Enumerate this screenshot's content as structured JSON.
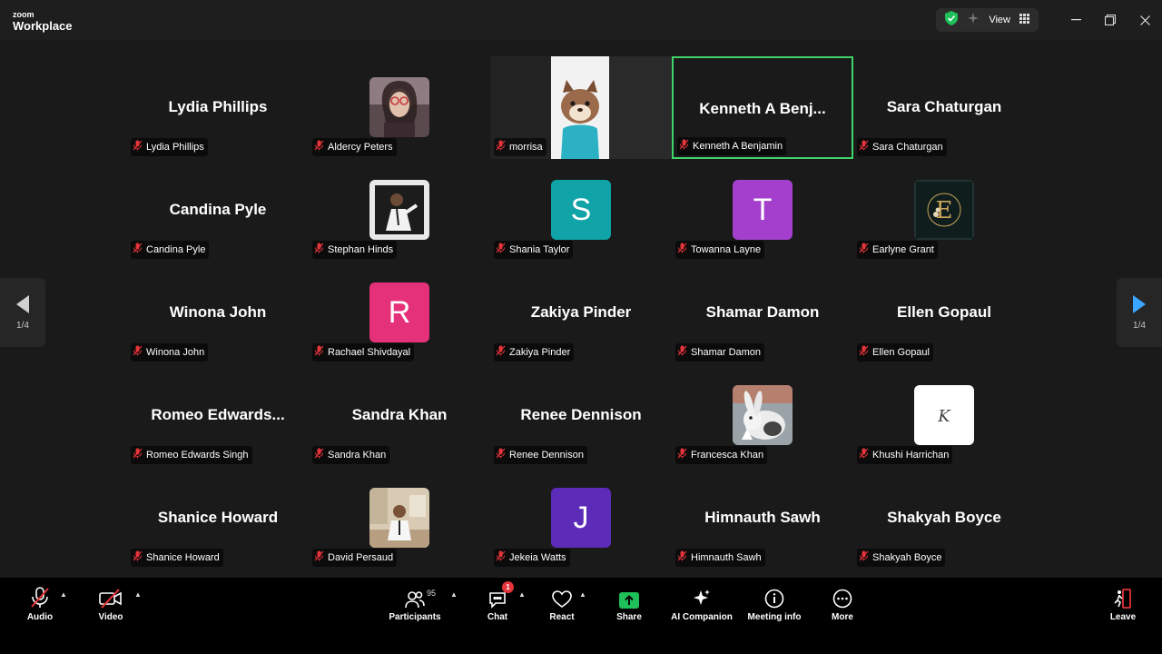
{
  "app": {
    "brand_top": "zoom",
    "brand_main": "Workplace"
  },
  "titlebar": {
    "view_label": "View"
  },
  "pagination": {
    "left": "1/4",
    "right": "1/4"
  },
  "tiles": [
    {
      "name": "Lydia Phillips",
      "big": "Lydia Phillips",
      "kind": "name"
    },
    {
      "name": "Aldercy Peters",
      "kind": "photo",
      "photo": "woman-glasses"
    },
    {
      "name": "morrisa",
      "kind": "video"
    },
    {
      "name": "Kenneth A Benjamin",
      "big": "Kenneth  A  Benj...",
      "kind": "name",
      "active": true
    },
    {
      "name": "Sara Chaturgan",
      "big": "Sara Chaturgan",
      "kind": "name"
    },
    {
      "name": "Candina Pyle",
      "big": "Candina Pyle",
      "kind": "name"
    },
    {
      "name": "Stephan Hinds",
      "kind": "photo",
      "photo": "man-dark"
    },
    {
      "name": "Shania Taylor",
      "kind": "letter",
      "letter": "S",
      "color": "#10a3a7"
    },
    {
      "name": "Towanna Layne",
      "kind": "letter",
      "letter": "T",
      "color": "#a33fcc"
    },
    {
      "name": "Earlyne Grant",
      "kind": "photo",
      "photo": "logo-e"
    },
    {
      "name": "Winona John",
      "big": "Winona John",
      "kind": "name"
    },
    {
      "name": "Rachael Shivdayal",
      "kind": "letter",
      "letter": "R",
      "color": "#e5317a"
    },
    {
      "name": "Zakiya Pinder",
      "big": "Zakiya Pinder",
      "kind": "name"
    },
    {
      "name": "Shamar Damon",
      "big": "Shamar Damon",
      "kind": "name"
    },
    {
      "name": "Ellen Gopaul",
      "big": "Ellen Gopaul",
      "kind": "name"
    },
    {
      "name": "Romeo Edwards Singh",
      "big": "Romeo  Edwards...",
      "kind": "name"
    },
    {
      "name": "Sandra Khan",
      "big": "Sandra Khan",
      "kind": "name"
    },
    {
      "name": "Renee Dennison",
      "big": "Renee Dennison",
      "kind": "name"
    },
    {
      "name": "Francesca Khan",
      "kind": "photo",
      "photo": "rabbit"
    },
    {
      "name": "Khushi Harrichan",
      "kind": "photo",
      "photo": "monogram-k"
    },
    {
      "name": "Shanice Howard",
      "big": "Shanice Howard",
      "kind": "name"
    },
    {
      "name": "David Persaud",
      "kind": "photo",
      "photo": "man-room"
    },
    {
      "name": "Jekeia Watts",
      "kind": "letter",
      "letter": "J",
      "color": "#5c2bb8"
    },
    {
      "name": "Himnauth Sawh",
      "big": "Himnauth Sawh",
      "kind": "name"
    },
    {
      "name": "Shakyah Boyce",
      "big": "Shakyah Boyce",
      "kind": "name"
    }
  ],
  "toolbar": {
    "audio": "Audio",
    "video": "Video",
    "participants": "Participants",
    "participants_count": "95",
    "chat": "Chat",
    "chat_badge": "1",
    "react": "React",
    "share": "Share",
    "ai": "AI Companion",
    "info": "Meeting info",
    "more": "More",
    "leave": "Leave"
  },
  "colors": {
    "active_border": "#3fd36a",
    "share_green": "#1fbf5a",
    "mute_red": "#e5343a",
    "nav_arrow": "#3aa6ff"
  }
}
